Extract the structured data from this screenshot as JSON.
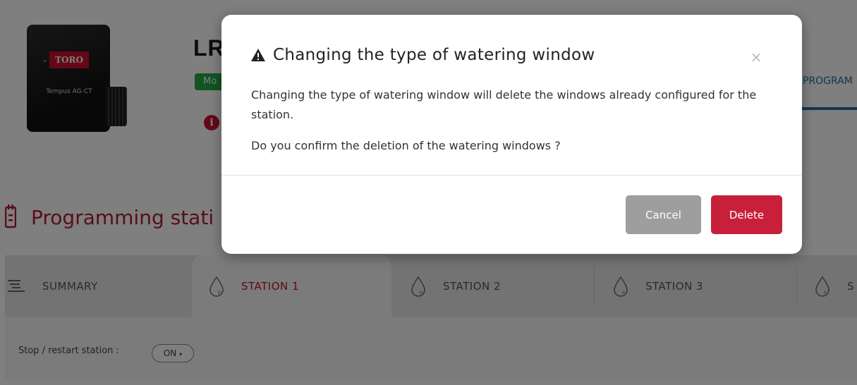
{
  "device": {
    "brand": "TORO",
    "model": "Tempus AG-CT"
  },
  "controller": {
    "name": "LR",
    "mode_badge": "Mo"
  },
  "header_tab": {
    "label": "PROGRAM"
  },
  "section": {
    "title": "Programming stati"
  },
  "tabs": [
    {
      "label": "SUMMARY",
      "icon": "summary-list-icon",
      "active": false
    },
    {
      "label": "STATION 1",
      "icon": "water-drop-icon",
      "active": true
    },
    {
      "label": "STATION 2",
      "icon": "water-drop-icon",
      "active": false
    },
    {
      "label": "STATION 3",
      "icon": "water-drop-icon",
      "active": false
    },
    {
      "label": "S",
      "icon": "water-drop-icon",
      "active": false
    }
  ],
  "station": {
    "stop_label": "Stop / restart station :",
    "toggle_value": "ON"
  },
  "modal": {
    "title": "Changing the type of watering window",
    "close": "×",
    "message": "Changing the type of watering window will delete the windows already configured for the station.",
    "confirm_question": "Do you confirm the deletion of the watering windows ?",
    "cancel_label": "Cancel",
    "delete_label": "Delete"
  },
  "colors": {
    "accent": "#c8102e",
    "delete": "#c8203a",
    "cancel": "#9e9e9e",
    "active_tab_text": "#c8102e",
    "program_tab": "#1f6f9c"
  }
}
